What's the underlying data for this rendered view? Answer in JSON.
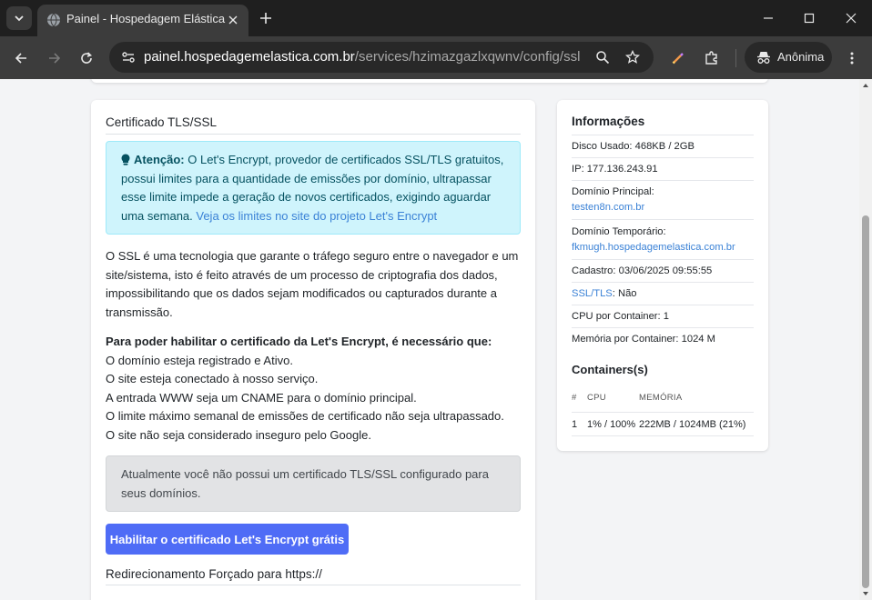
{
  "browser": {
    "tab_title": "Painel - Hospedagem Elástica",
    "url_host": "painel.hospedagemelastica.com.br",
    "url_path": "/services/hzimazgazlxqwnv/config/ssl",
    "incognito_label": "Anônima"
  },
  "main": {
    "title": "Certificado TLS/SSL",
    "alert": {
      "bold": "Atenção:",
      "text": " O Let's Encrypt, provedor de certificados SSL/TLS gratuitos, possui limites para a quantidade de emissões por domínio, ultrapassar esse limite impede a geração de novos certificados, exigindo aguardar uma semana. ",
      "link": "Veja os limites no site do projeto Let's Encrypt"
    },
    "description": "O SSL é uma tecnologia que garante o tráfego seguro entre o navegador e um site/sistema, isto é feito através de um processo de criptografia dos dados, impossibilitando que os dados sejam modificados ou capturados durante a transmissão.",
    "requirements_heading": "Para poder habilitar o certificado da Let's Encrypt, é necessário que:",
    "requirements": [
      "O domínio esteja registrado e Ativo.",
      "O site esteja conectado à nosso serviço.",
      "A entrada WWW seja um CNAME para o domínio principal.",
      "O limite máximo semanal de emissões de certificado não seja ultrapassado.",
      "O site não seja considerado inseguro pelo Google."
    ],
    "notice": "Atualmente você não possui um certificado TLS/SSL configurado para seus domínios.",
    "enable_button": "Habilitar o certificado Let's Encrypt grátis",
    "redirect_title": "Redirecionamento Forçado para https://"
  },
  "info": {
    "title": "Informações",
    "disk": "Disco Usado: 468KB / 2GB",
    "ip": "IP: 177.136.243.91",
    "main_domain_label": "Domínio Principal:",
    "main_domain": "testen8n.com.br",
    "temp_domain_label": "Domínio Temporário:",
    "temp_domain": "fkmugh.hospedagemelastica.com.br",
    "registered": "Cadastro: 03/06/2025 09:55:55",
    "ssl_label": "SSL/TLS",
    "ssl_value": ": Não",
    "cpu": "CPU por Container: 1",
    "memory": "Memória por Container: 1024 M",
    "containers_title": "Containers(s)",
    "table_headers": [
      "#",
      "CPU",
      "MEMÓRIA"
    ],
    "rows": [
      {
        "id": "1",
        "cpu": "1% / 100%",
        "memory": "222MB / 1024MB (21%)"
      }
    ]
  },
  "colors": {
    "primary": "#4f6cf6",
    "link": "#3b82d6",
    "alert_bg": "#cff4fc",
    "notice_bg": "#e2e3e5"
  }
}
